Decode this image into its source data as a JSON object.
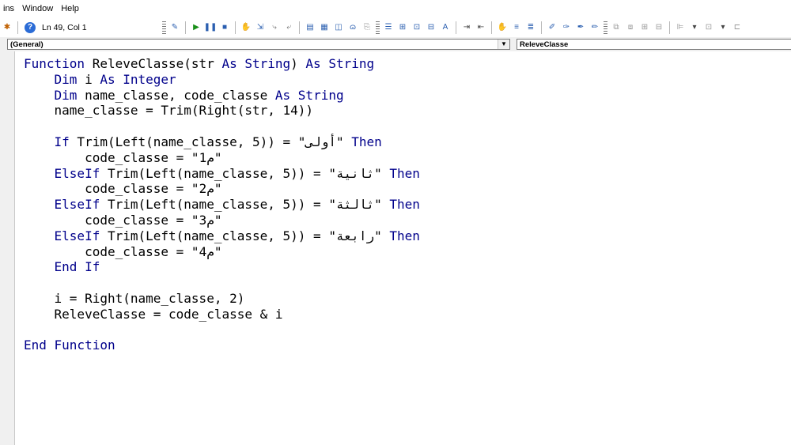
{
  "menu": {
    "items": [
      "ins",
      "Window",
      "Help"
    ]
  },
  "toolbar": {
    "position": "Ln 49, Col 1",
    "help_icon": "?"
  },
  "object_combo": "(General)",
  "proc_combo": "ReleveClasse",
  "code_lines": [
    [
      {
        "t": "Function",
        "k": 1
      },
      {
        "t": " ReleveClasse(str "
      },
      {
        "t": "As",
        "k": 1
      },
      {
        "t": " "
      },
      {
        "t": "String",
        "k": 1
      },
      {
        "t": ") "
      },
      {
        "t": "As",
        "k": 1
      },
      {
        "t": " "
      },
      {
        "t": "String",
        "k": 1
      }
    ],
    [
      {
        "t": "    "
      },
      {
        "t": "Dim",
        "k": 1
      },
      {
        "t": " i "
      },
      {
        "t": "As",
        "k": 1
      },
      {
        "t": " "
      },
      {
        "t": "Integer",
        "k": 1
      }
    ],
    [
      {
        "t": "    "
      },
      {
        "t": "Dim",
        "k": 1
      },
      {
        "t": " name_classe, code_classe "
      },
      {
        "t": "As",
        "k": 1
      },
      {
        "t": " "
      },
      {
        "t": "String",
        "k": 1
      }
    ],
    [
      {
        "t": "    name_classe = Trim(Right(str, 14))"
      }
    ],
    [
      {
        "t": ""
      }
    ],
    [
      {
        "t": "    "
      },
      {
        "t": "If",
        "k": 1
      },
      {
        "t": " Trim(Left(name_classe, 5)) = \"أولى\" "
      },
      {
        "t": "Then",
        "k": 1
      }
    ],
    [
      {
        "t": "        code_classe = \"م1\""
      }
    ],
    [
      {
        "t": "    "
      },
      {
        "t": "ElseIf",
        "k": 1
      },
      {
        "t": " Trim(Left(name_classe, 5)) = \"ثانية\" "
      },
      {
        "t": "Then",
        "k": 1
      }
    ],
    [
      {
        "t": "        code_classe = \"م2\""
      }
    ],
    [
      {
        "t": "    "
      },
      {
        "t": "ElseIf",
        "k": 1
      },
      {
        "t": " Trim(Left(name_classe, 5)) = \"ثالثة\" "
      },
      {
        "t": "Then",
        "k": 1
      }
    ],
    [
      {
        "t": "        code_classe = \"م3\""
      }
    ],
    [
      {
        "t": "    "
      },
      {
        "t": "ElseIf",
        "k": 1
      },
      {
        "t": " Trim(Left(name_classe, 5)) = \"رابعة\" "
      },
      {
        "t": "Then",
        "k": 1
      }
    ],
    [
      {
        "t": "        code_classe = \"م4\""
      }
    ],
    [
      {
        "t": "    "
      },
      {
        "t": "End If",
        "k": 1
      }
    ],
    [
      {
        "t": ""
      }
    ],
    [
      {
        "t": "    i = Right(name_classe, 2)"
      }
    ],
    [
      {
        "t": "    ReleveClasse = code_classe & i"
      }
    ],
    [
      {
        "t": ""
      }
    ],
    [
      {
        "t": "End Function",
        "k": 1
      }
    ]
  ]
}
